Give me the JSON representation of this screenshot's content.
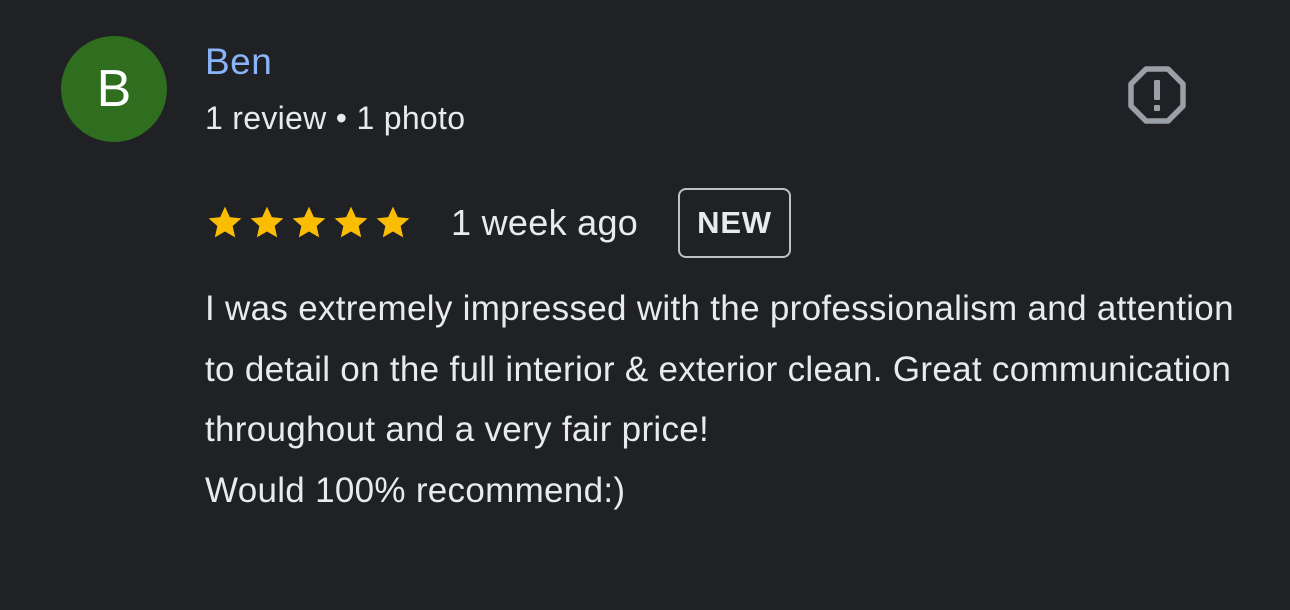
{
  "author": {
    "avatar_letter": "B",
    "name": "Ben",
    "meta": "1 review • 1 photo",
    "avatar_color": "#2f6d1f",
    "name_color": "#8ab4f8"
  },
  "report": {
    "icon": "report-icon"
  },
  "rating": {
    "stars": 5,
    "max_stars": 5,
    "star_color": "#fbbc04",
    "time_ago": "1 week ago",
    "badge": "NEW"
  },
  "review": {
    "text": "I was extremely impressed with the professionalism and attention to detail on the full interior & exterior clean. Great communication throughout and a very fair price!\nWould 100% recommend:)"
  }
}
